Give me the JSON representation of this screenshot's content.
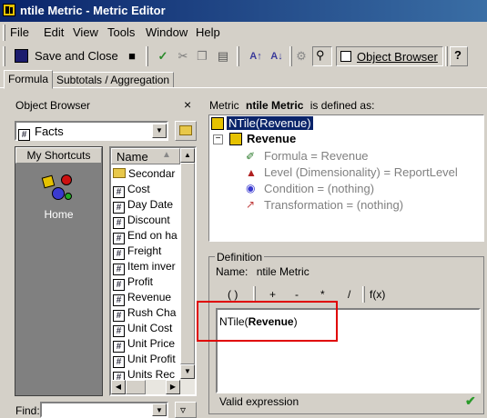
{
  "window": {
    "title": "ntile Metric - Metric Editor"
  },
  "menu": [
    "File",
    "Edit",
    "View",
    "Tools",
    "Window",
    "Help"
  ],
  "toolbar": {
    "save_close_label": "Save and Close",
    "object_browser_label": "Object Browser"
  },
  "tabs": [
    "Formula",
    "Subtotals / Aggregation"
  ],
  "object_browser": {
    "title": "Object Browser",
    "close_glyph": "×",
    "folder_value": "Facts",
    "shortcuts_label": "My Shortcuts",
    "home_label": "Home",
    "list_header": "Name",
    "items": [
      {
        "label": "Secondar",
        "icon": "folder"
      },
      {
        "label": "Cost",
        "icon": "hash"
      },
      {
        "label": "Day Date",
        "icon": "hash"
      },
      {
        "label": "Discount",
        "icon": "hash"
      },
      {
        "label": "End on ha",
        "icon": "hash"
      },
      {
        "label": "Freight",
        "icon": "hash"
      },
      {
        "label": "Item inver",
        "icon": "hash"
      },
      {
        "label": "Profit",
        "icon": "hash"
      },
      {
        "label": "Revenue",
        "icon": "hash"
      },
      {
        "label": "Rush Cha",
        "icon": "hash"
      },
      {
        "label": "Unit Cost",
        "icon": "hash"
      },
      {
        "label": "Unit Price",
        "icon": "hash"
      },
      {
        "label": "Unit Profit",
        "icon": "hash"
      },
      {
        "label": "Units Rec",
        "icon": "hash"
      }
    ],
    "find_label": "Find:"
  },
  "metric": {
    "defined_prefix": "Metric",
    "name": "ntile Metric",
    "defined_suffix": "is defined as:",
    "root": "NTile(Revenue)",
    "child": "Revenue",
    "formula": "Formula = Revenue",
    "level": "Level (Dimensionality) = ReportLevel",
    "condition": "Condition = (nothing)",
    "transformation": "Transformation = (nothing)"
  },
  "definition": {
    "group_label": "Definition",
    "name_label": "Name:",
    "name_value": "ntile Metric",
    "operators": [
      "( )",
      "+",
      "-",
      "*",
      "/",
      "f(x)"
    ],
    "formula_prefix": "NTile(",
    "formula_bold": "Revenue",
    "formula_suffix": ")",
    "status": "Valid expression"
  }
}
